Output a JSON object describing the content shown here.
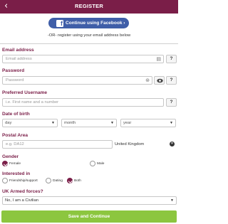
{
  "header": {
    "back_glyph": "‹",
    "title": "REGISTER"
  },
  "facebook": {
    "icon": "facebook-icon",
    "logo_letter": "f",
    "button_label": "Continue using Facebook ›"
  },
  "or_text": "-OR- register using your email address below",
  "email": {
    "label": "Email address",
    "placeholder": "Email address",
    "help": "?"
  },
  "password": {
    "label": "Password",
    "placeholder": "Password",
    "help": "?"
  },
  "username": {
    "label": "Preferred Username",
    "placeholder": "i.e. First name and a number",
    "help": "?"
  },
  "dob": {
    "label": "Date of birth",
    "day": "day",
    "month": "month",
    "year": "year"
  },
  "postal": {
    "label": "Postal Area",
    "placeholder": "e.g. DA12",
    "country": "United Kingdom"
  },
  "gender": {
    "label": "Gender",
    "options": [
      "Female",
      "Male"
    ],
    "selected": "Female"
  },
  "interested": {
    "label": "Interested in",
    "options": [
      "Friendship/support",
      "Dating",
      "Both"
    ],
    "selected": "Both"
  },
  "armed_forces": {
    "label": "UK Armed forces?",
    "value": "No, I am a Civilian"
  },
  "submit_label": "Save and Continue",
  "colors": {
    "brand": "#7a1e48",
    "facebook": "#3f5ea8",
    "submit": "#8cc63f"
  }
}
